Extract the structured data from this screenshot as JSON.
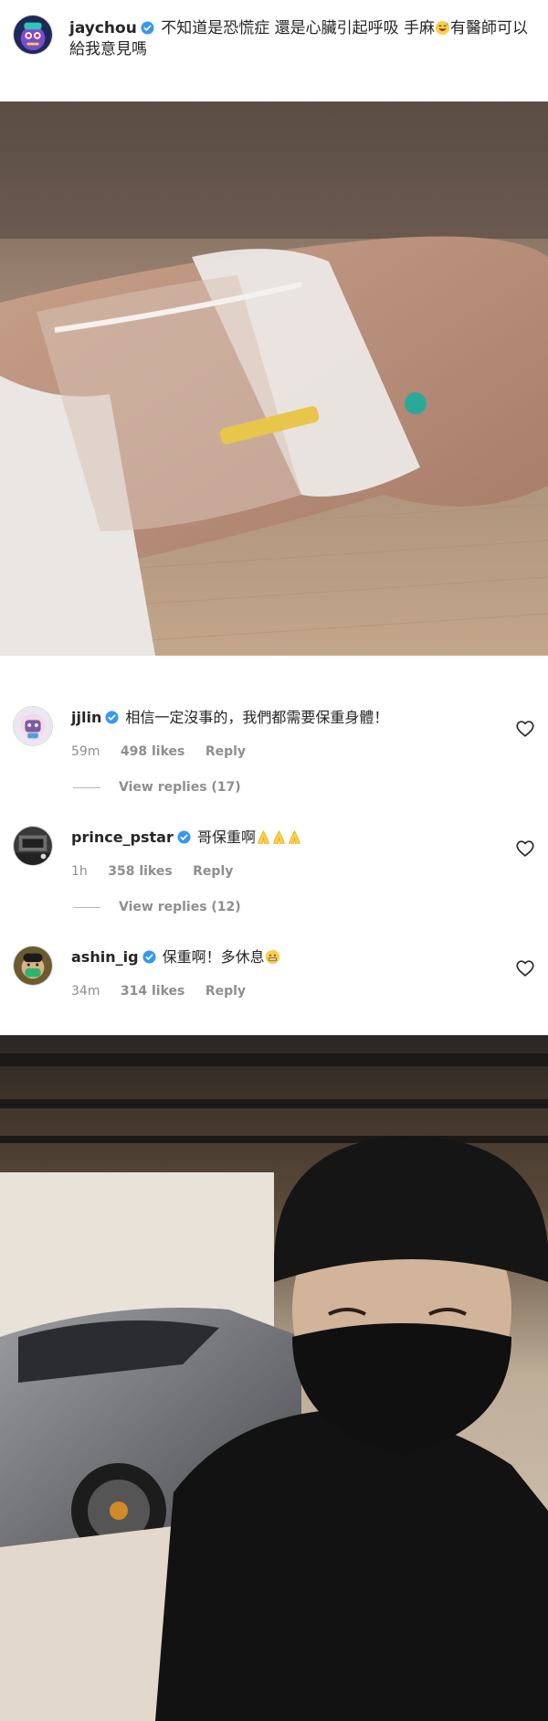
{
  "post": {
    "username": "jaychou",
    "caption_text": "不知道是恐慌症 還是心臟引起呼吸 手麻",
    "caption_tail": "有醫師可以給我意見嗎",
    "caption_emoji": "sweat-smile-emoji"
  },
  "comments": [
    {
      "username": "jjlin",
      "text": "相信一定沒事的，我們都需要保重身體！",
      "time": "59m",
      "likes": "498 likes",
      "reply": "Reply",
      "view_replies": "View replies (17)"
    },
    {
      "username": "prince_pstar",
      "text": "哥保重啊",
      "emoji": "folded-hands-emoji",
      "time": "1h",
      "likes": "358 likes",
      "reply": "Reply",
      "view_replies": "View replies (12)"
    },
    {
      "username": "ashin_ig",
      "text": "保重啊！多休息",
      "emoji": "grimacing-face-emoji",
      "time": "34m",
      "likes": "314 likes",
      "reply": "Reply"
    }
  ],
  "icons": {
    "verified": "verified-badge-icon",
    "like": "heart-icon"
  },
  "colors": {
    "verified_blue": "#3897f0",
    "meta_gray": "#8e8e8e",
    "text": "#262626"
  }
}
